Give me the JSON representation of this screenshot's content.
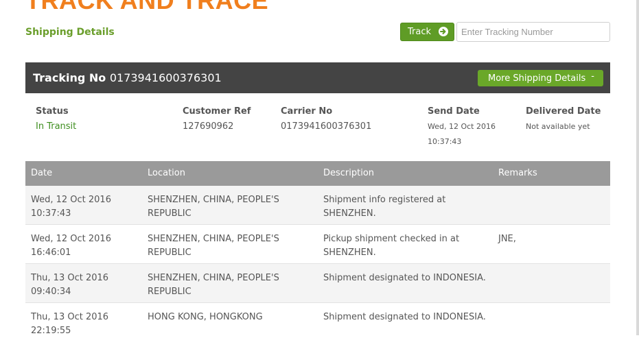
{
  "page": {
    "title": "TRACK AND TRACE",
    "subtitle": "Shipping Details"
  },
  "search": {
    "button_label": "Track",
    "placeholder": "Enter Tracking Number",
    "value": ""
  },
  "tracking": {
    "label": "Tracking No",
    "number": "0173941600376301",
    "more_button_label": "More Shipping Details",
    "more_button_symbol": "-"
  },
  "summary": {
    "status": {
      "label": "Status",
      "value": "In Transit"
    },
    "customer_ref": {
      "label": "Customer Ref",
      "value": "127690962"
    },
    "carrier_no": {
      "label": "Carrier No",
      "value": "0173941600376301"
    },
    "send_date": {
      "label": "Send Date",
      "value": "Wed, 12 Oct 2016 10:37:43"
    },
    "delivered_date": {
      "label": "Delivered Date",
      "value": "Not available yet"
    }
  },
  "table": {
    "headers": {
      "date": "Date",
      "location": "Location",
      "description": "Description",
      "remarks": "Remarks"
    },
    "rows": [
      {
        "date": "Wed, 12 Oct 2016 10:37:43",
        "location": "SHENZHEN, CHINA, PEOPLE'S REPUBLIC",
        "description": "Shipment info registered at SHENZHEN.",
        "remarks": ""
      },
      {
        "date": "Wed, 12 Oct 2016 16:46:01",
        "location": "SHENZHEN, CHINA, PEOPLE'S REPUBLIC",
        "description": "Pickup shipment checked in at SHENZHEN.",
        "remarks": "JNE,"
      },
      {
        "date": "Thu, 13 Oct 2016 09:40:34",
        "location": "SHENZHEN, CHINA, PEOPLE'S REPUBLIC",
        "description": "Shipment designated to INDONESIA.",
        "remarks": ""
      },
      {
        "date": "Thu, 13 Oct 2016 22:19:55",
        "location": "HONG KONG, HONGKONG",
        "description": "Shipment designated to INDONESIA.",
        "remarks": ""
      }
    ]
  },
  "colors": {
    "title_orange": "#f07f1e",
    "brand_green": "#5f9c26",
    "status_green": "#3e8e1f",
    "bar_dark": "#444444",
    "header_gray": "#9a9a9a"
  },
  "icons": {
    "track_button_icon": "arrow-right-circle-icon"
  }
}
